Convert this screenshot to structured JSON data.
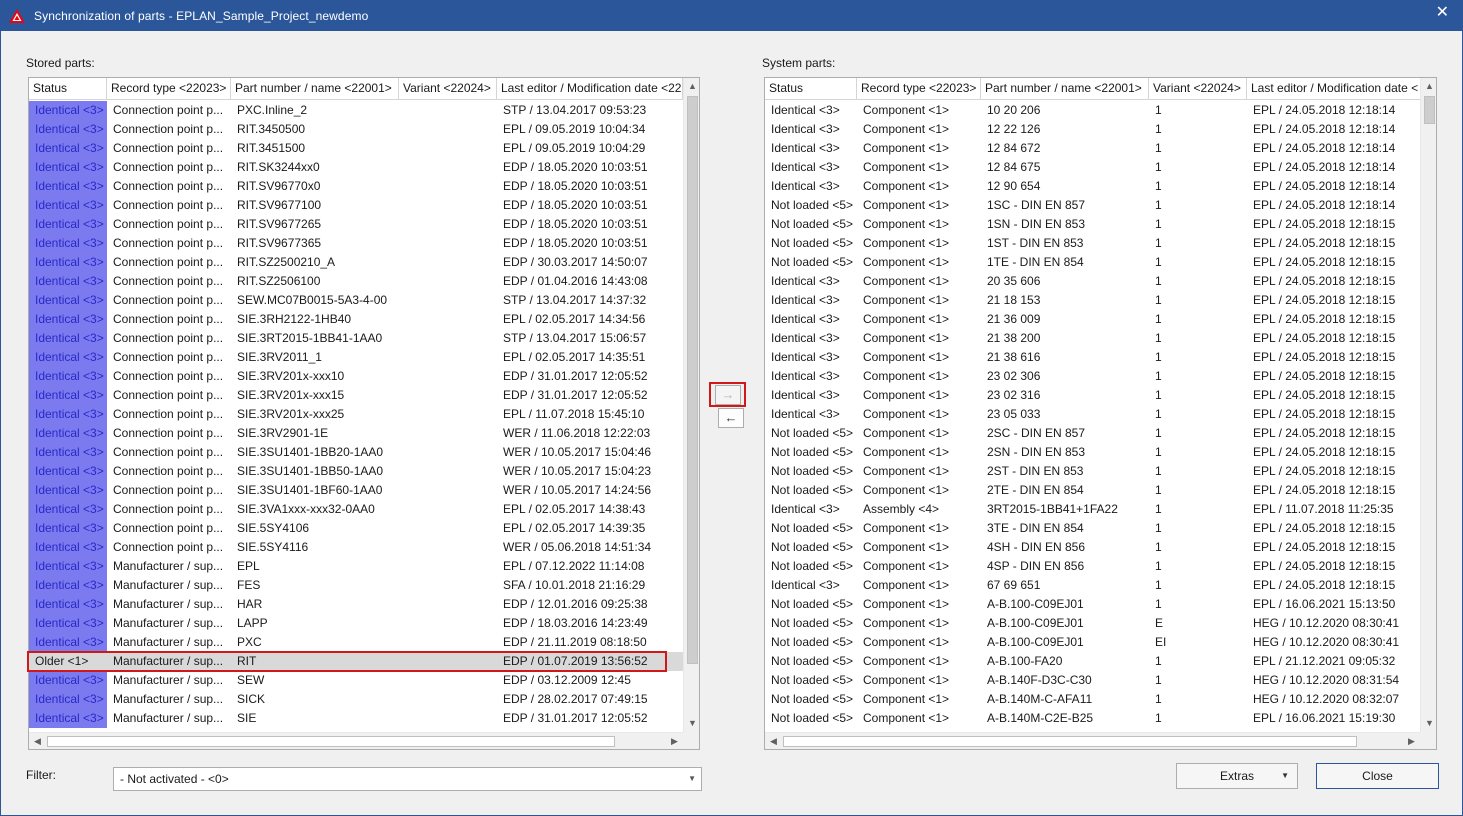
{
  "window": {
    "title": "Synchronization of parts - EPLAN_Sample_Project_newdemo",
    "close_glyph": "✕"
  },
  "left": {
    "label": "Stored parts:",
    "columns": [
      "Status",
      "Record type <22023>",
      "Part number / name <22001>",
      "Variant <22024>",
      "Last editor / Modification date <22"
    ],
    "rows": [
      [
        "Identical <3>",
        "Connection point p...",
        "PXC.Inline_2",
        "",
        "STP / 13.04.2017 09:53:23"
      ],
      [
        "Identical <3>",
        "Connection point p...",
        "RIT.3450500",
        "",
        "EPL / 09.05.2019 10:04:34"
      ],
      [
        "Identical <3>",
        "Connection point p...",
        "RIT.3451500",
        "",
        "EPL / 09.05.2019 10:04:29"
      ],
      [
        "Identical <3>",
        "Connection point p...",
        "RIT.SK3244xx0",
        "",
        "EDP / 18.05.2020 10:03:51"
      ],
      [
        "Identical <3>",
        "Connection point p...",
        "RIT.SV96770x0",
        "",
        "EDP / 18.05.2020 10:03:51"
      ],
      [
        "Identical <3>",
        "Connection point p...",
        "RIT.SV9677100",
        "",
        "EDP / 18.05.2020 10:03:51"
      ],
      [
        "Identical <3>",
        "Connection point p...",
        "RIT.SV9677265",
        "",
        "EDP / 18.05.2020 10:03:51"
      ],
      [
        "Identical <3>",
        "Connection point p...",
        "RIT.SV9677365",
        "",
        "EDP / 18.05.2020 10:03:51"
      ],
      [
        "Identical <3>",
        "Connection point p...",
        "RIT.SZ2500210_A",
        "",
        "EDP / 30.03.2017 14:50:07"
      ],
      [
        "Identical <3>",
        "Connection point p...",
        "RIT.SZ2506100",
        "",
        "EDP / 01.04.2016 14:43:08"
      ],
      [
        "Identical <3>",
        "Connection point p...",
        "SEW.MC07B0015-5A3-4-00",
        "",
        "STP / 13.04.2017 14:37:32"
      ],
      [
        "Identical <3>",
        "Connection point p...",
        "SIE.3RH2122-1HB40",
        "",
        "EPL / 02.05.2017 14:34:56"
      ],
      [
        "Identical <3>",
        "Connection point p...",
        "SIE.3RT2015-1BB41-1AA0",
        "",
        "STP / 13.04.2017 15:06:57"
      ],
      [
        "Identical <3>",
        "Connection point p...",
        "SIE.3RV2011_1",
        "",
        "EPL / 02.05.2017 14:35:51"
      ],
      [
        "Identical <3>",
        "Connection point p...",
        "SIE.3RV201x-xxx10",
        "",
        "EDP / 31.01.2017 12:05:52"
      ],
      [
        "Identical <3>",
        "Connection point p...",
        "SIE.3RV201x-xxx15",
        "",
        "EDP / 31.01.2017 12:05:52"
      ],
      [
        "Identical <3>",
        "Connection point p...",
        "SIE.3RV201x-xxx25",
        "",
        "EPL / 11.07.2018 15:45:10"
      ],
      [
        "Identical <3>",
        "Connection point p...",
        "SIE.3RV2901-1E",
        "",
        "WER / 11.06.2018 12:22:03"
      ],
      [
        "Identical <3>",
        "Connection point p...",
        "SIE.3SU1401-1BB20-1AA0",
        "",
        "WER / 10.05.2017 15:04:46"
      ],
      [
        "Identical <3>",
        "Connection point p...",
        "SIE.3SU1401-1BB50-1AA0",
        "",
        "WER / 10.05.2017 15:04:23"
      ],
      [
        "Identical <3>",
        "Connection point p...",
        "SIE.3SU1401-1BF60-1AA0",
        "",
        "WER / 10.05.2017 14:24:56"
      ],
      [
        "Identical <3>",
        "Connection point p...",
        "SIE.3VA1xxx-xxx32-0AA0",
        "",
        "EPL / 02.05.2017 14:38:43"
      ],
      [
        "Identical <3>",
        "Connection point p...",
        "SIE.5SY4106",
        "",
        "EPL / 02.05.2017 14:39:35"
      ],
      [
        "Identical <3>",
        "Connection point p...",
        "SIE.5SY4116",
        "",
        "WER / 05.06.2018 14:51:34"
      ],
      [
        "Identical <3>",
        "Manufacturer / sup...",
        "EPL",
        "",
        "EPL / 07.12.2022 11:14:08"
      ],
      [
        "Identical <3>",
        "Manufacturer / sup...",
        "FES",
        "",
        "SFA / 10.01.2018 21:16:29"
      ],
      [
        "Identical <3>",
        "Manufacturer / sup...",
        "HAR",
        "",
        "EDP / 12.01.2016 09:25:38"
      ],
      [
        "Identical <3>",
        "Manufacturer / sup...",
        "LAPP",
        "",
        "EDP / 18.03.2016 14:23:49"
      ],
      [
        "Identical <3>",
        "Manufacturer / sup...",
        "PXC",
        "",
        "EDP / 21.11.2019 08:18:50"
      ],
      [
        "Older <1>",
        "Manufacturer / sup...",
        "RIT",
        "",
        "EDP / 01.07.2019 13:56:52"
      ],
      [
        "Identical <3>",
        "Manufacturer / sup...",
        "SEW",
        "",
        "EDP / 03.12.2009 12:45"
      ],
      [
        "Identical <3>",
        "Manufacturer / sup...",
        "SICK",
        "",
        "EDP / 28.02.2017 07:49:15"
      ],
      [
        "Identical <3>",
        "Manufacturer / sup...",
        "SIE",
        "",
        "EDP / 31.01.2017 12:05:52"
      ]
    ]
  },
  "right": {
    "label": "System parts:",
    "columns": [
      "Status",
      "Record type <22023>",
      "Part number / name <22001>",
      "Variant <22024>",
      "Last editor / Modification date <"
    ],
    "rows": [
      [
        "Identical <3>",
        "Component <1>",
        "10 20 206",
        "1",
        "EPL / 24.05.2018 12:18:14"
      ],
      [
        "Identical <3>",
        "Component <1>",
        "12 22 126",
        "1",
        "EPL / 24.05.2018 12:18:14"
      ],
      [
        "Identical <3>",
        "Component <1>",
        "12 84 672",
        "1",
        "EPL / 24.05.2018 12:18:14"
      ],
      [
        "Identical <3>",
        "Component <1>",
        "12 84 675",
        "1",
        "EPL / 24.05.2018 12:18:14"
      ],
      [
        "Identical <3>",
        "Component <1>",
        "12 90 654",
        "1",
        "EPL / 24.05.2018 12:18:14"
      ],
      [
        "Not loaded <5>",
        "Component <1>",
        "1SC - DIN EN 857",
        "1",
        "EPL / 24.05.2018 12:18:14"
      ],
      [
        "Not loaded <5>",
        "Component <1>",
        "1SN - DIN EN 853",
        "1",
        "EPL / 24.05.2018 12:18:15"
      ],
      [
        "Not loaded <5>",
        "Component <1>",
        "1ST - DIN EN 853",
        "1",
        "EPL / 24.05.2018 12:18:15"
      ],
      [
        "Not loaded <5>",
        "Component <1>",
        "1TE - DIN EN 854",
        "1",
        "EPL / 24.05.2018 12:18:15"
      ],
      [
        "Identical <3>",
        "Component <1>",
        "20 35 606",
        "1",
        "EPL / 24.05.2018 12:18:15"
      ],
      [
        "Identical <3>",
        "Component <1>",
        "21 18 153",
        "1",
        "EPL / 24.05.2018 12:18:15"
      ],
      [
        "Identical <3>",
        "Component <1>",
        "21 36 009",
        "1",
        "EPL / 24.05.2018 12:18:15"
      ],
      [
        "Identical <3>",
        "Component <1>",
        "21 38 200",
        "1",
        "EPL / 24.05.2018 12:18:15"
      ],
      [
        "Identical <3>",
        "Component <1>",
        "21 38 616",
        "1",
        "EPL / 24.05.2018 12:18:15"
      ],
      [
        "Identical <3>",
        "Component <1>",
        "23 02 306",
        "1",
        "EPL / 24.05.2018 12:18:15"
      ],
      [
        "Identical <3>",
        "Component <1>",
        "23 02 316",
        "1",
        "EPL / 24.05.2018 12:18:15"
      ],
      [
        "Identical <3>",
        "Component <1>",
        "23 05 033",
        "1",
        "EPL / 24.05.2018 12:18:15"
      ],
      [
        "Not loaded <5>",
        "Component <1>",
        "2SC - DIN EN 857",
        "1",
        "EPL / 24.05.2018 12:18:15"
      ],
      [
        "Not loaded <5>",
        "Component <1>",
        "2SN - DIN EN 853",
        "1",
        "EPL / 24.05.2018 12:18:15"
      ],
      [
        "Not loaded <5>",
        "Component <1>",
        "2ST - DIN EN 853",
        "1",
        "EPL / 24.05.2018 12:18:15"
      ],
      [
        "Not loaded <5>",
        "Component <1>",
        "2TE - DIN EN 854",
        "1",
        "EPL / 24.05.2018 12:18:15"
      ],
      [
        "Identical <3>",
        "Assembly <4>",
        "3RT2015-1BB41+1FA22",
        "1",
        "EPL / 11.07.2018 11:25:35"
      ],
      [
        "Not loaded <5>",
        "Component <1>",
        "3TE - DIN EN 854",
        "1",
        "EPL / 24.05.2018 12:18:15"
      ],
      [
        "Not loaded <5>",
        "Component <1>",
        "4SH - DIN EN 856",
        "1",
        "EPL / 24.05.2018 12:18:15"
      ],
      [
        "Not loaded <5>",
        "Component <1>",
        "4SP - DIN EN 856",
        "1",
        "EPL / 24.05.2018 12:18:15"
      ],
      [
        "Identical <3>",
        "Component <1>",
        "67 69 651",
        "1",
        "EPL / 24.05.2018 12:18:15"
      ],
      [
        "Not loaded <5>",
        "Component <1>",
        "A-B.100-C09EJ01",
        "1",
        "EPL / 16.06.2021 15:13:50"
      ],
      [
        "Not loaded <5>",
        "Component <1>",
        "A-B.100-C09EJ01",
        "E",
        "HEG / 10.12.2020 08:30:41"
      ],
      [
        "Not loaded <5>",
        "Component <1>",
        "A-B.100-C09EJ01",
        "EI",
        "HEG / 10.12.2020 08:30:41"
      ],
      [
        "Not loaded <5>",
        "Component <1>",
        "A-B.100-FA20",
        "1",
        "EPL / 21.12.2021 09:05:32"
      ],
      [
        "Not loaded <5>",
        "Component <1>",
        "A-B.140F-D3C-C30",
        "1",
        "HEG / 10.12.2020 08:31:54"
      ],
      [
        "Not loaded <5>",
        "Component <1>",
        "A-B.140M-C-AFA11",
        "1",
        "HEG / 10.12.2020 08:32:07"
      ],
      [
        "Not loaded <5>",
        "Component <1>",
        "A-B.140M-C2E-B25",
        "1",
        "EPL / 16.06.2021 15:19:30"
      ]
    ]
  },
  "transfer": {
    "to_system_glyph": "→",
    "to_stored_glyph": "←"
  },
  "filter": {
    "label": "Filter:",
    "value": "- Not activated - <0>"
  },
  "buttons": {
    "extras": "Extras",
    "close": "Close"
  },
  "colors": {
    "title_bar": "#2b579a",
    "identical_status_bg": "#7b7bef",
    "selection_frame": "#d01818"
  }
}
